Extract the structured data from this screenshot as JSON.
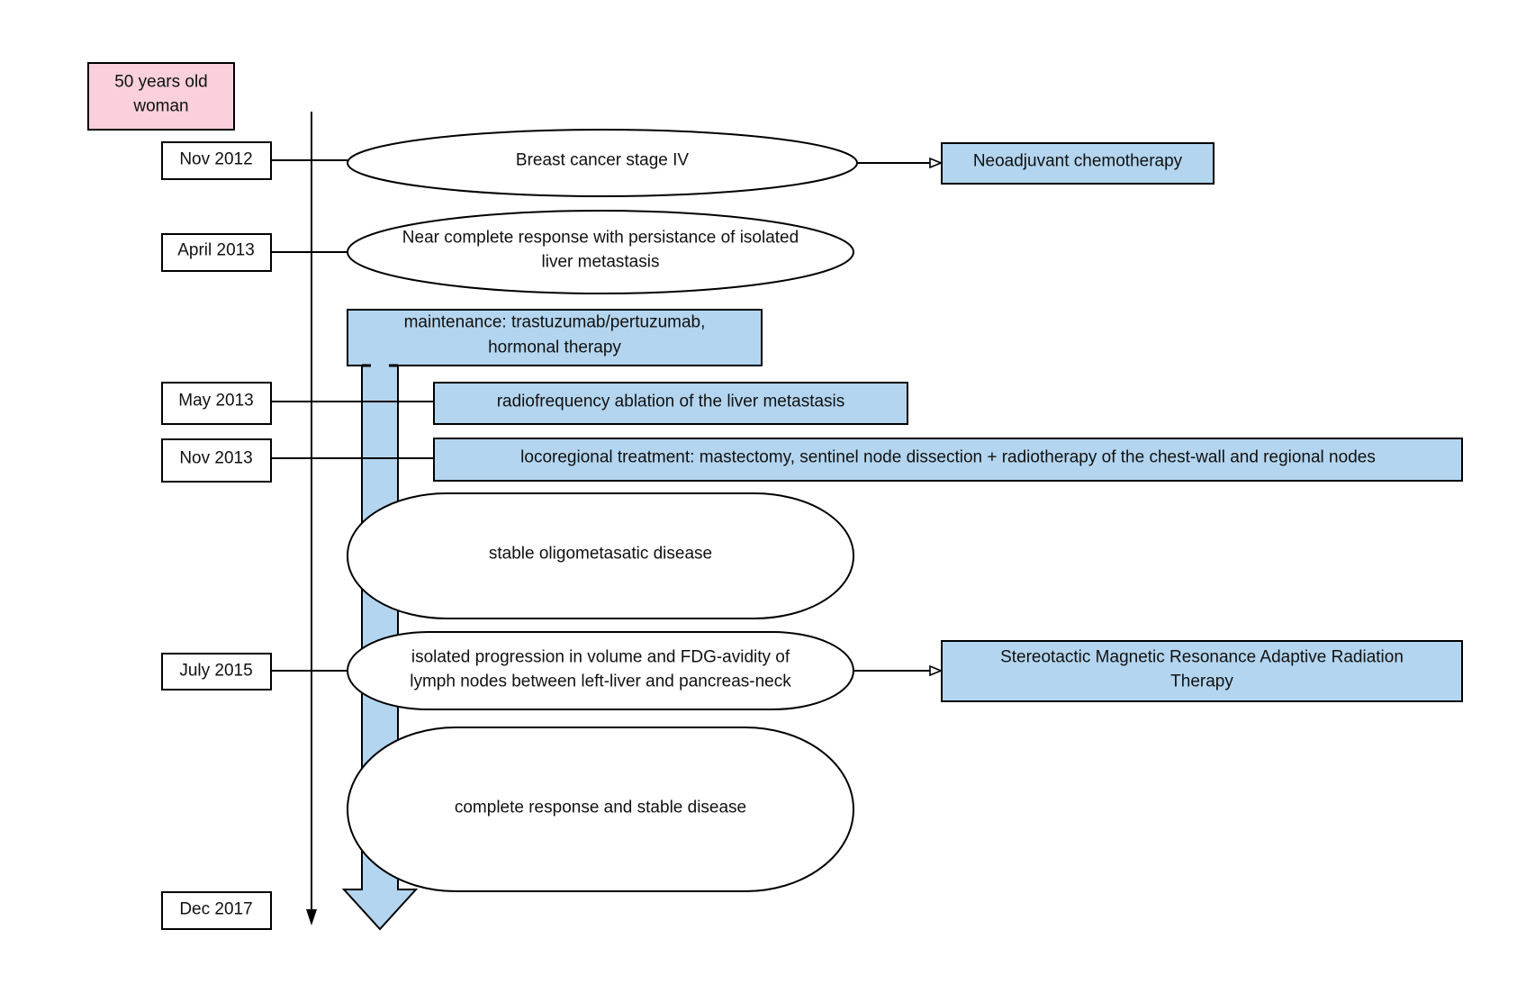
{
  "colors": {
    "patient_fill": "#f9d0dc",
    "treatment_fill": "#b3d5ef",
    "event_fill": "#ffffff",
    "date_fill": "#ffffff",
    "stroke": "#000000",
    "timeline_bar_fill": "#b3d5ef"
  },
  "patient": {
    "lines": [
      "50 years old",
      "woman"
    ]
  },
  "timeline": {
    "icon": "arrow-down-icon",
    "dates": [
      {
        "id": "nov-2012",
        "label": "Nov 2012"
      },
      {
        "id": "april-2013",
        "label": "April 2013"
      },
      {
        "id": "may-2013",
        "label": "May 2013"
      },
      {
        "id": "nov-2013",
        "label": "Nov 2013"
      },
      {
        "id": "july-2015",
        "label": "July 2015"
      },
      {
        "id": "dec-2017",
        "label": "Dec 2017"
      }
    ]
  },
  "events": [
    {
      "id": "breast-cancer-stage-iv",
      "lines": [
        "Breast cancer stage IV"
      ]
    },
    {
      "id": "near-complete-response",
      "lines": [
        "Near complete response with persistance of isolated",
        "liver metastasis"
      ]
    },
    {
      "id": "stable-oligometastatic-disease",
      "lines": [
        "stable oligometasatic disease"
      ]
    },
    {
      "id": "isolated-progression",
      "lines": [
        "isolated progression in volume and FDG-avidity of",
        "lymph nodes between left-liver and pancreas-neck"
      ]
    },
    {
      "id": "complete-response",
      "lines": [
        "complete response and stable disease"
      ]
    }
  ],
  "treatments": [
    {
      "id": "neoadjuvant-chemotherapy",
      "lines": [
        "Neoadjuvant chemotherapy"
      ]
    },
    {
      "id": "maintenance-therapy",
      "lines": [
        "maintenance: trastuzumab/pertuzumab,",
        "hormonal therapy"
      ]
    },
    {
      "id": "radiofrequency-ablation",
      "lines": [
        "radiofrequency ablation of the liver metastasis"
      ]
    },
    {
      "id": "locoregional-treatment",
      "lines": [
        "locoregional treatment: mastectomy, sentinel node dissection + radiotherapy of the chest-wall and regional nodes"
      ]
    },
    {
      "id": "smart-radiation-therapy",
      "lines": [
        "Stereotactic Magnetic Resonance Adaptive Radiation",
        "Therapy"
      ]
    }
  ]
}
